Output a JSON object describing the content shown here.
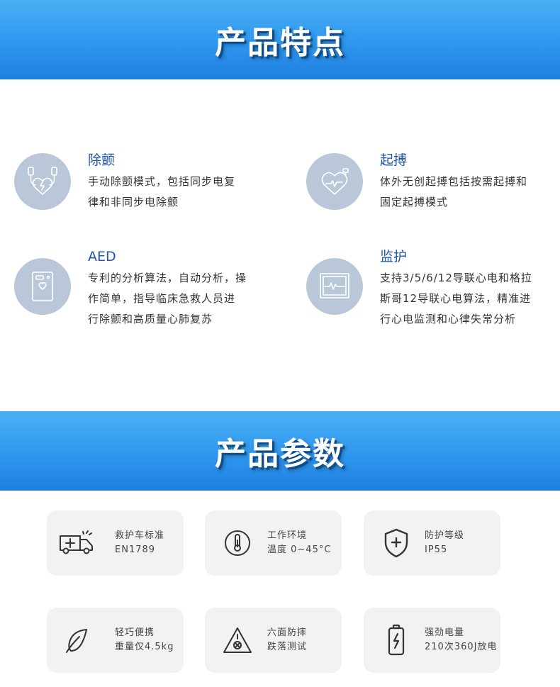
{
  "sections": {
    "features_title": "产品特点",
    "params_title": "产品参数"
  },
  "features": [
    {
      "title": "除颤",
      "lines": [
        "手动除颤模式，包括同步电复",
        "律和非同步电除颤"
      ]
    },
    {
      "title": "起搏",
      "lines": [
        "体外无创起搏包括按需起搏和",
        "固定起搏模式"
      ]
    },
    {
      "title": "AED",
      "lines": [
        "专利的分析算法，自动分析，操",
        "作简单，指导临床急救人员进",
        "行除颤和高质量心肺复苏"
      ]
    },
    {
      "title": "监护",
      "lines": [
        "支持3/5/6/12导联心电和格拉",
        "斯哥12导联心电算法，精准进",
        "行心电监测和心律失常分析"
      ]
    }
  ],
  "params": [
    {
      "label": "救护车标准",
      "value": "EN1789",
      "icon": "ambulance-icon"
    },
    {
      "label": "工作环境",
      "value": "温度 0~45°C",
      "icon": "thermometer-icon"
    },
    {
      "label": "防护等级",
      "value": "IP55",
      "icon": "shield-plus-icon"
    },
    {
      "label": "轻巧便携",
      "value": "重量仅4.5kg",
      "icon": "feather-icon"
    },
    {
      "label": "六面防摔",
      "value": "跌落测试",
      "icon": "drop-warning-icon"
    },
    {
      "label": "强劲电量",
      "value": "210次360J放电",
      "icon": "battery-icon"
    }
  ],
  "colors": {
    "banner": "#2e97ee",
    "feature_title": "#2156a8",
    "icon_circle": "#b9c7d8",
    "card": "#f1f2f4"
  }
}
